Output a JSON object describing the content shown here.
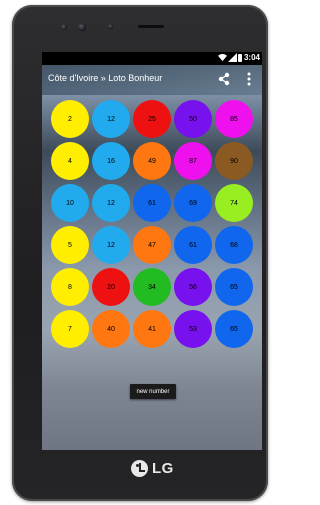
{
  "device": {
    "brand": "LG"
  },
  "statusbar": {
    "time": "3:04",
    "icons": [
      "wifi-icon",
      "signal-icon",
      "battery-icon"
    ]
  },
  "appbar": {
    "title": "Côte d'Ivoire » Loto Bonheur",
    "share_icon": "share-icon",
    "menu_icon": "overflow-menu-icon"
  },
  "grid": {
    "rows": [
      [
        {
          "n": "2",
          "c": "#ffee00"
        },
        {
          "n": "12",
          "c": "#22aaee"
        },
        {
          "n": "25",
          "c": "#ee1111"
        },
        {
          "n": "50",
          "c": "#7711ee"
        },
        {
          "n": "85",
          "c": "#ee11ee"
        }
      ],
      [
        {
          "n": "4",
          "c": "#ffee00"
        },
        {
          "n": "16",
          "c": "#22aaee"
        },
        {
          "n": "49",
          "c": "#ff7711"
        },
        {
          "n": "87",
          "c": "#ee11ee"
        },
        {
          "n": "90",
          "c": "#8b5a22"
        }
      ],
      [
        {
          "n": "10",
          "c": "#22aaee"
        },
        {
          "n": "12",
          "c": "#22aaee"
        },
        {
          "n": "61",
          "c": "#1166ee"
        },
        {
          "n": "69",
          "c": "#1166ee"
        },
        {
          "n": "74",
          "c": "#99ee22"
        }
      ],
      [
        {
          "n": "5",
          "c": "#ffee00"
        },
        {
          "n": "12",
          "c": "#22aaee"
        },
        {
          "n": "47",
          "c": "#ff7711"
        },
        {
          "n": "61",
          "c": "#1166ee"
        },
        {
          "n": "68",
          "c": "#1166ee"
        }
      ],
      [
        {
          "n": "8",
          "c": "#ffee00"
        },
        {
          "n": "20",
          "c": "#ee1111"
        },
        {
          "n": "34",
          "c": "#22bb22"
        },
        {
          "n": "56",
          "c": "#7711ee"
        },
        {
          "n": "65",
          "c": "#1166ee"
        }
      ],
      [
        {
          "n": "7",
          "c": "#ffee00"
        },
        {
          "n": "40",
          "c": "#ff7711"
        },
        {
          "n": "41",
          "c": "#ff7711"
        },
        {
          "n": "53",
          "c": "#7711ee"
        },
        {
          "n": "65",
          "c": "#1166ee"
        }
      ]
    ]
  },
  "actions": {
    "new_number_label": "new number"
  }
}
